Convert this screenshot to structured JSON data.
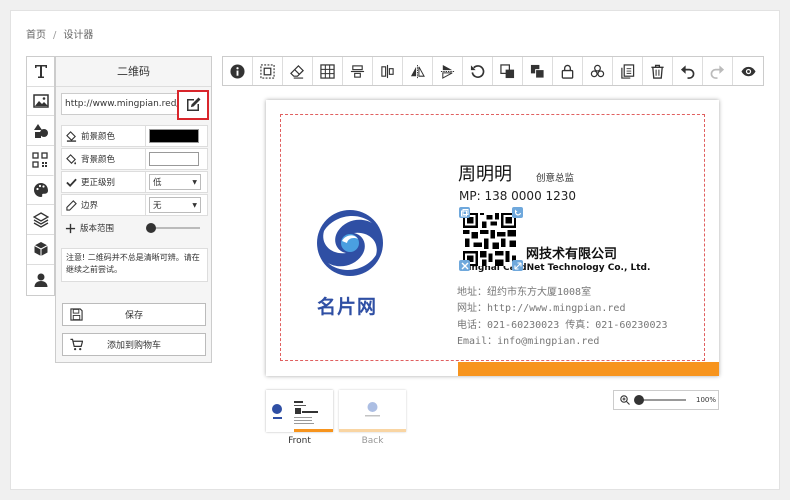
{
  "breadcrumb": {
    "home": "首页",
    "separator": "/",
    "current": "设计器"
  },
  "left_rail": {
    "items": [
      {
        "icon": "text-icon"
      },
      {
        "icon": "image-icon"
      },
      {
        "icon": "shapes-icon"
      },
      {
        "icon": "qrcode-icon",
        "active": true
      },
      {
        "icon": "palette-icon"
      },
      {
        "icon": "layers-icon"
      },
      {
        "icon": "box-icon"
      },
      {
        "icon": "user-icon"
      }
    ]
  },
  "panel": {
    "title": "二维码",
    "url_value": "http://www.mingpian.red/",
    "edit_icon": "edit-icon",
    "props": {
      "fg_label": "前景颜色",
      "fg_color": "#000000",
      "bg_label": "背景颜色",
      "bg_color": "#ffffff",
      "ecc_label": "更正级别",
      "ecc_value": "低",
      "border_label": "边界",
      "border_value": "无",
      "version_label": "版本范围"
    },
    "note": "注意! 二维码并不总是清晰可辨。请在继续之前尝试。",
    "save_label": "保存",
    "cart_label": "添加到购物车"
  },
  "toolbar": {
    "buttons": [
      "info-icon",
      "select-icon",
      "eraser-icon",
      "grid-icon",
      "align-center-icon",
      "align-middle-icon",
      "flip-horizontal-icon",
      "flip-vertical-icon",
      "undo-rotate-icon",
      "bring-forward-icon",
      "send-backward-icon",
      "lock-icon",
      "group-icon",
      "copy-icon",
      "trash-icon",
      "undo-icon",
      "redo-icon",
      "preview-icon"
    ]
  },
  "card": {
    "logo_text": "名片网",
    "name": "周明明",
    "role": "创意总监",
    "mp": "MP: 138 0000 1230",
    "company_cn": "网技术有限公司",
    "company_en": "hanghai CardNet Technology Co., Ltd.",
    "address": "地址：纽约市东方大厦1008室",
    "website": "网址：http://www.mingpian.red",
    "phone": "电话：021-60230023  传真：021-60230023",
    "email": "Email：info@mingpian.red",
    "accent_color": "#f7941d",
    "logo_color": "#2f4fa4"
  },
  "thumbnails": {
    "front": "Front",
    "back": "Back"
  },
  "zoom": {
    "value": "100%",
    "level": 0.0
  }
}
